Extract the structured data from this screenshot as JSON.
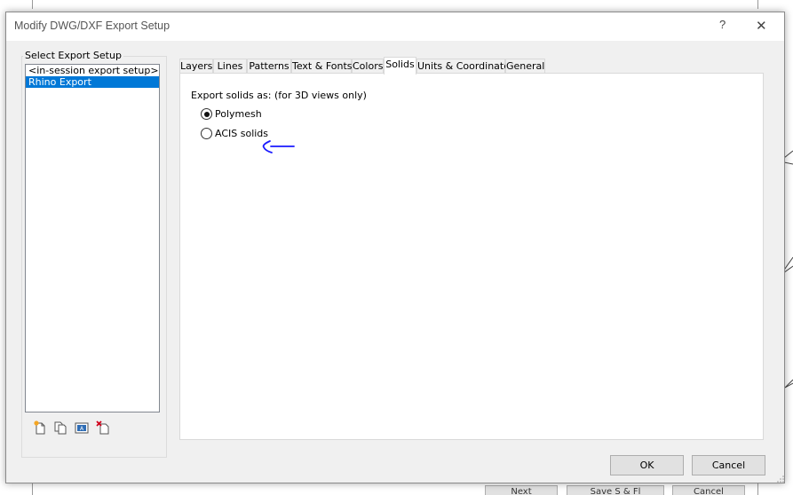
{
  "dialog": {
    "title": "Modify DWG/DXF Export Setup",
    "help_glyph": "?",
    "close_glyph": "✕"
  },
  "setup_group": {
    "label": "Select Export Setup",
    "items": [
      {
        "label": "<in-session export setup>",
        "selected": false
      },
      {
        "label": "Rhino Export",
        "selected": true
      }
    ],
    "toolbar_icons": [
      "new-setup-icon",
      "duplicate-setup-icon",
      "rename-setup-icon",
      "delete-setup-icon"
    ]
  },
  "tabs": [
    {
      "label": "Layers",
      "active": false
    },
    {
      "label": "Lines",
      "active": false
    },
    {
      "label": "Patterns",
      "active": false
    },
    {
      "label": "Text & Fonts",
      "active": false
    },
    {
      "label": "Colors",
      "active": false
    },
    {
      "label": "Solids",
      "active": true
    },
    {
      "label": "Units & Coordinates",
      "active": false
    },
    {
      "label": "General",
      "active": false
    }
  ],
  "solids_panel": {
    "export_label": "Export solids as: (for 3D views only)",
    "options": [
      {
        "label": "Polymesh",
        "checked": true
      },
      {
        "label": "ACIS solids",
        "checked": false
      }
    ],
    "annotation_color": "#1a1aff"
  },
  "buttons": {
    "ok": "OK",
    "cancel": "Cancel"
  },
  "background_buttons": [
    "Next",
    "Save S & Fl",
    "Cancel"
  ],
  "colors": {
    "selection": "#0078d7",
    "dialog_bg": "#f0f0f0"
  }
}
